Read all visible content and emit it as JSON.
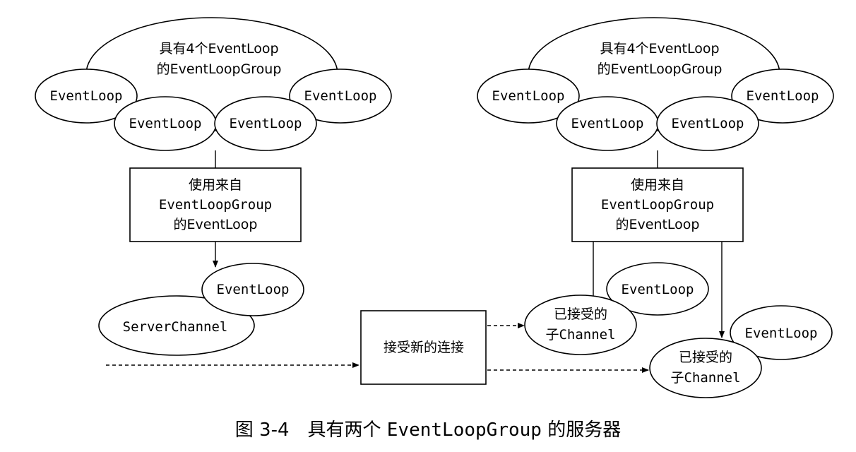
{
  "group_left": {
    "title_line1": "具有4个EventLoop",
    "title_line2": "的EventLoopGroup",
    "loops": [
      "EventLoop",
      "EventLoop",
      "EventLoop",
      "EventLoop"
    ]
  },
  "group_right": {
    "title_line1": "具有4个EventLoop",
    "title_line2": "的EventLoopGroup",
    "loops": [
      "EventLoop",
      "EventLoop",
      "EventLoop",
      "EventLoop"
    ]
  },
  "box_left": {
    "line1": "使用来自",
    "line2": "EventLoopGroup",
    "line3": "的EventLoop"
  },
  "box_right": {
    "line1": "使用来自",
    "line2": "EventLoopGroup",
    "line3": "的EventLoop"
  },
  "server": {
    "loop": "EventLoop",
    "channel": "ServerChannel"
  },
  "accept_box": {
    "label": "接受新的连接"
  },
  "child1": {
    "loop": "EventLoop",
    "line1": "已接受的",
    "line2": "子Channel"
  },
  "child2": {
    "loop": "EventLoop",
    "line1": "已接受的",
    "line2": "子Channel"
  },
  "caption": {
    "prefix": "图 3-4　具有两个 ",
    "mono": "EventLoopGroup",
    "suffix": " 的服务器"
  }
}
